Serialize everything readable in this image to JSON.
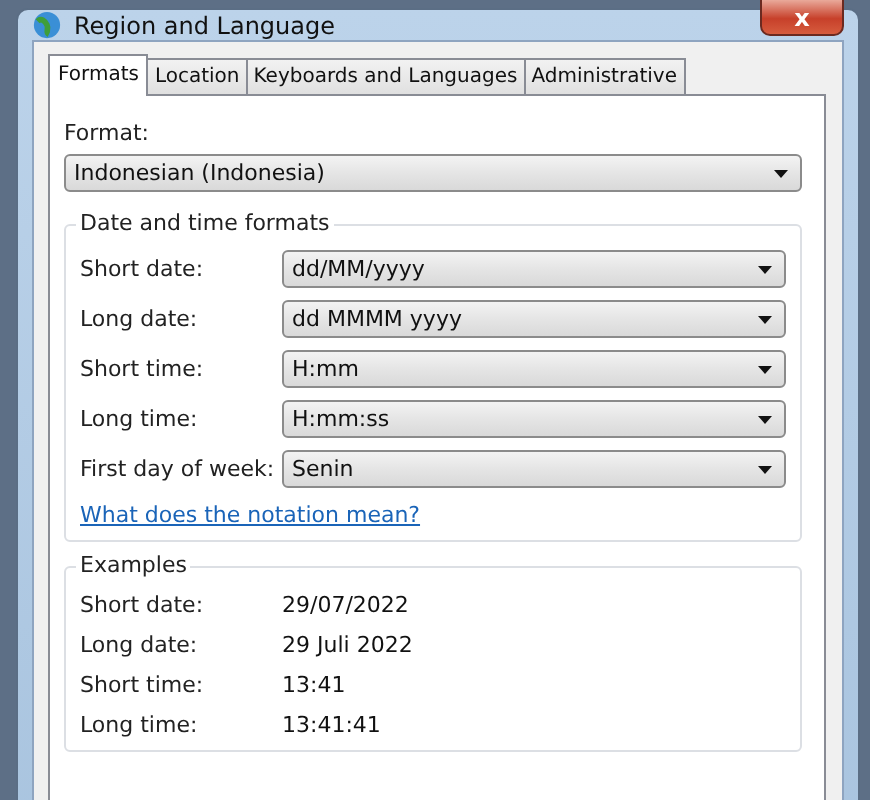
{
  "window": {
    "title": "Region and Language",
    "close": "x"
  },
  "tabs": [
    {
      "label": "Formats",
      "selected": true
    },
    {
      "label": "Location",
      "selected": false
    },
    {
      "label": "Keyboards and Languages",
      "selected": false
    },
    {
      "label": "Administrative",
      "selected": false
    }
  ],
  "format": {
    "label": "Format:",
    "value": "Indonesian (Indonesia)"
  },
  "date_time_formats": {
    "title": "Date and time formats",
    "rows": [
      {
        "label": "Short date:",
        "value": "dd/MM/yyyy"
      },
      {
        "label": "Long date:",
        "value": "dd MMMM yyyy"
      },
      {
        "label": "Short time:",
        "value": "H:mm"
      },
      {
        "label": "Long time:",
        "value": "H:mm:ss"
      },
      {
        "label": "First day of week:",
        "value": "Senin"
      }
    ],
    "link": "What does the notation mean?"
  },
  "examples": {
    "title": "Examples",
    "rows": [
      {
        "label": "Short date:",
        "value": "29/07/2022"
      },
      {
        "label": "Long date:",
        "value": "29 Juli 2022"
      },
      {
        "label": "Short time:",
        "value": "13:41"
      },
      {
        "label": "Long time:",
        "value": "13:41:41"
      }
    ]
  }
}
